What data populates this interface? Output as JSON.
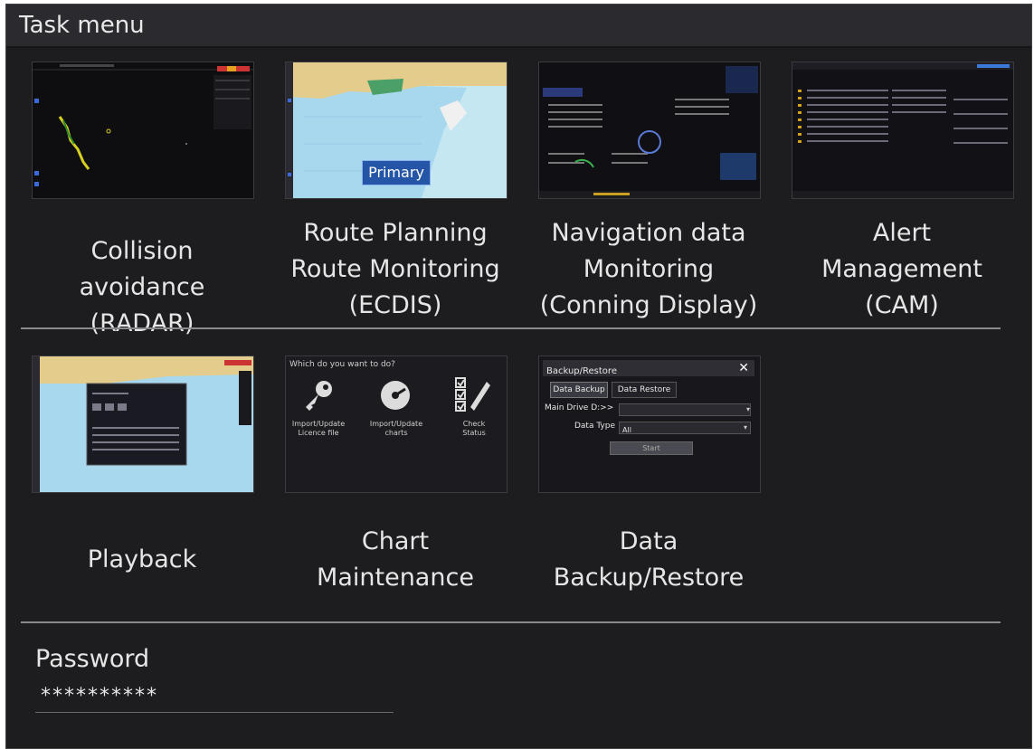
{
  "window": {
    "title": "Task menu"
  },
  "tasks": [
    {
      "label": "Collision avoidance\n(RADAR)"
    },
    {
      "label": "Route Planning\nRoute Monitoring\n(ECDIS)",
      "badge": "Primary"
    },
    {
      "label": "Navigation data\nMonitoring\n(Conning Display)"
    },
    {
      "label": "Alert\nManagement\n(CAM)"
    },
    {
      "label": "Playback"
    },
    {
      "label": "Chart\nMaintenance",
      "thumb": {
        "prompt": "Which do you want to do?",
        "items": [
          {
            "label": "Import/Update Licence file",
            "icon": "key-icon"
          },
          {
            "label": "Import/Update charts",
            "icon": "disc-icon"
          },
          {
            "label": "Check Status",
            "icon": "checklist-icon"
          }
        ]
      }
    },
    {
      "label": "Data\nBackup/Restore",
      "thumb": {
        "title": "Backup/Restore",
        "tabs": [
          "Data Backup",
          "Data Restore"
        ],
        "field1_label": "Main Drive D:>>",
        "field2_label": "Data Type",
        "field2_value": "All",
        "start": "Start"
      }
    }
  ],
  "password": {
    "label": "Password",
    "value": "**********"
  },
  "colors": {
    "background": "#1d1c1f",
    "text": "#e6e6e6",
    "sea": "#9fd0ea",
    "land": "#e0c88a",
    "primary_badge": "#2455a6"
  }
}
